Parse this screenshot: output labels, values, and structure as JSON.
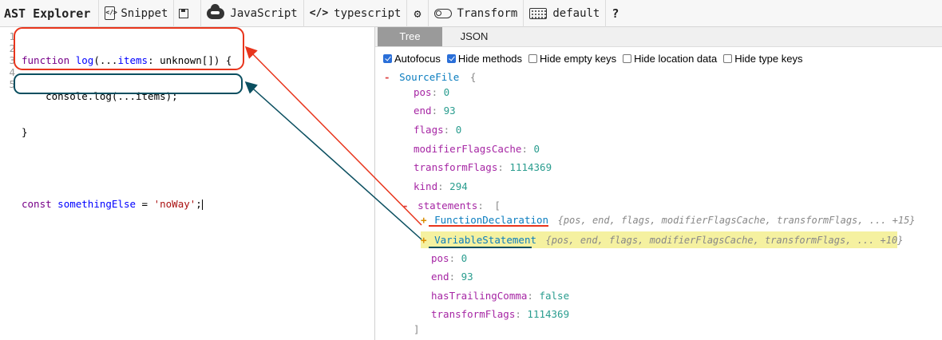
{
  "toolbar": {
    "title": "AST Explorer",
    "snippet": "Snippet",
    "language": "JavaScript",
    "parser": "typescript",
    "transform": "Transform",
    "keymap": "default",
    "help": "?"
  },
  "editor": {
    "line_numbers": [
      "1",
      "2",
      "3",
      "4",
      "5"
    ]
  },
  "tabs": {
    "tree": "Tree",
    "json": "JSON"
  },
  "options": [
    {
      "label": "Autofocus",
      "checked": true
    },
    {
      "label": "Hide methods",
      "checked": true
    },
    {
      "label": "Hide empty keys",
      "checked": false
    },
    {
      "label": "Hide location data",
      "checked": false
    },
    {
      "label": "Hide type keys",
      "checked": false
    }
  ],
  "tree": {
    "root_toggle": "-",
    "root_name": "SourceFile",
    "root_brace": "{",
    "props": [
      {
        "key": "pos",
        "value": "0"
      },
      {
        "key": "end",
        "value": "93"
      },
      {
        "key": "flags",
        "value": "0"
      },
      {
        "key": "modifierFlagsCache",
        "value": "0"
      },
      {
        "key": "transformFlags",
        "value": "1114369"
      },
      {
        "key": "kind",
        "value": "294"
      }
    ],
    "statements_toggle": "-",
    "statements_key": "statements",
    "statements_bracket": "[",
    "function_decl": {
      "toggle": "+",
      "name": "FunctionDeclaration",
      "summary": "{pos, end, flags, modifierFlagsCache, transformFlags, ... +15}"
    },
    "variable_stmt": {
      "toggle": "+",
      "name": "VariableStatement",
      "summary": "{pos, end, flags, modifierFlagsCache, transformFlags, ... +10}"
    },
    "array_props": [
      {
        "key": "pos",
        "value": "0"
      },
      {
        "key": "end",
        "value": "93"
      },
      {
        "key": "hasTrailingComma",
        "value": "false"
      },
      {
        "key": "transformFlags",
        "value": "1114369"
      }
    ],
    "close_bracket": "]"
  },
  "colors": {
    "red_annotation": "#e8351c",
    "teal_annotation": "#0b4f60",
    "highlight": "#f5f1a0"
  }
}
